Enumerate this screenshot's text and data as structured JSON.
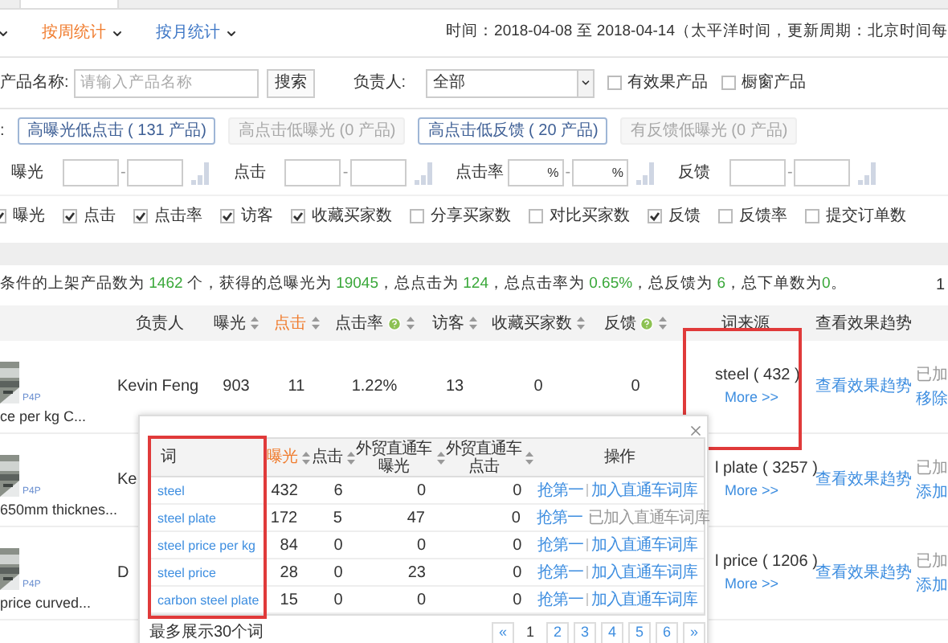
{
  "tabs": [
    {
      "label": "按周统计",
      "selected": true
    },
    {
      "label": "按月统计",
      "selected": false
    }
  ],
  "time_range": "时间：2018-04-08 至 2018-04-14（太平洋时间，更新周期：北京时间每",
  "filters": {
    "product_label": "产品名称:",
    "product_placeholder": "请输入产品名称",
    "search_button": "搜索",
    "owner_label": "负责人:",
    "owner_value": "全部",
    "checkboxes": [
      {
        "label": "有效果产品",
        "checked": false
      },
      {
        "label": "橱窗产品",
        "checked": false
      }
    ]
  },
  "quick_label": ":",
  "quick_filters": [
    {
      "label": "高曝光低点击 ( 131 产品)",
      "disabled": false
    },
    {
      "label": "高点击低曝光 (0 产品)",
      "disabled": true
    },
    {
      "label": "高点击低反馈 ( 20 产品)",
      "disabled": false
    },
    {
      "label": "有反馈低曝光 (0 产品)",
      "disabled": true
    }
  ],
  "ranges": [
    {
      "label": "曝光",
      "separator": "-"
    },
    {
      "label": "点击",
      "separator": "-"
    },
    {
      "label": "点击率",
      "separator": "-",
      "unit": "%"
    },
    {
      "label": "反馈",
      "separator": "-"
    }
  ],
  "columns_toggle": [
    {
      "label": "曝光",
      "checked": true
    },
    {
      "label": "点击",
      "checked": true
    },
    {
      "label": "点击率",
      "checked": true
    },
    {
      "label": "访客",
      "checked": true
    },
    {
      "label": "收藏买家数",
      "checked": true
    },
    {
      "label": "分享买家数",
      "checked": false
    },
    {
      "label": "对比买家数",
      "checked": false
    },
    {
      "label": "反馈",
      "checked": true
    },
    {
      "label": "反馈率",
      "checked": false
    },
    {
      "label": "提交订单数",
      "checked": false
    }
  ],
  "summary": [
    {
      "text": "条件的上架产品数为 ",
      "highlight": false
    },
    {
      "text": "1462",
      "highlight": true
    },
    {
      "text": " 个，获得的总曝光为 ",
      "highlight": false
    },
    {
      "text": "19045",
      "highlight": true
    },
    {
      "text": "，总点击为 ",
      "highlight": false
    },
    {
      "text": "124",
      "highlight": true
    },
    {
      "text": "，总点击率为 ",
      "highlight": false
    },
    {
      "text": "0.65%",
      "highlight": true
    },
    {
      "text": "，总反馈为 ",
      "highlight": false
    },
    {
      "text": "6",
      "highlight": true
    },
    {
      "text": "，总下单数为",
      "highlight": false
    },
    {
      "text": "0",
      "highlight": true
    },
    {
      "text": "。",
      "highlight": false
    }
  ],
  "summary_edge": "1",
  "table": {
    "columns": [
      {
        "label": "负责人",
        "sortable": false,
        "help": false,
        "active": false
      },
      {
        "label": "曝光",
        "sortable": true,
        "help": false,
        "active": false
      },
      {
        "label": "点击",
        "sortable": true,
        "help": false,
        "active": true
      },
      {
        "label": "点击率",
        "sortable": true,
        "help": true,
        "active": false
      },
      {
        "label": "访客",
        "sortable": true,
        "help": false,
        "active": false
      },
      {
        "label": "收藏买家数",
        "sortable": true,
        "help": false,
        "active": false
      },
      {
        "label": "反馈",
        "sortable": true,
        "help": true,
        "active": false
      },
      {
        "label": "词来源",
        "sortable": false,
        "help": false,
        "active": false
      },
      {
        "label": "查看效果趋势",
        "sortable": false,
        "help": false,
        "active": false
      }
    ],
    "rows": [
      {
        "badge": "P4P",
        "product": "ce per kg C...",
        "owner": "Kevin Feng",
        "values": [
          "903",
          "11",
          "1.22%",
          "13",
          "0",
          "0"
        ],
        "source": "steel ( 432 )",
        "more": "More >>",
        "trend": "查看效果趋势",
        "status": "已加",
        "action": "移除"
      },
      {
        "badge": "P4P",
        "product": "650mm thicknes...",
        "owner": "Ke",
        "values": [],
        "source": "l plate ( 3257 )",
        "more": "More >>",
        "trend": "查看效果趋势",
        "status": "已加",
        "action": "添加"
      },
      {
        "badge": "P4P",
        "product": "price curved...",
        "owner": "D",
        "values": [],
        "source": "l price ( 1206 )",
        "more": "More >>",
        "trend": "查看效果趋势",
        "status": "已加",
        "action": "添加"
      }
    ]
  },
  "popup": {
    "columns": [
      {
        "label": "词",
        "sortable": false,
        "active": false
      },
      {
        "label": "曝光",
        "sortable": true,
        "active": true
      },
      {
        "label": "点击",
        "sortable": true,
        "active": false
      },
      {
        "label": "外贸直通车曝光",
        "sortable": true,
        "active": false
      },
      {
        "label": "外贸直通车点击",
        "sortable": true,
        "active": false
      },
      {
        "label": "操作",
        "sortable": false,
        "active": false
      }
    ],
    "rows": [
      {
        "word": "steel",
        "exposure": "432",
        "clicks": "6",
        "p4p_exposure": "0",
        "p4p_clicks": "0",
        "grab": "抢第一",
        "action": "加入直通车词库",
        "added": false
      },
      {
        "word": "steel plate",
        "exposure": "172",
        "clicks": "5",
        "p4p_exposure": "47",
        "p4p_clicks": "0",
        "grab": "抢第一",
        "action": "已加入直通车词库",
        "added": true
      },
      {
        "word": "steel price per kg",
        "exposure": "84",
        "clicks": "0",
        "p4p_exposure": "0",
        "p4p_clicks": "0",
        "grab": "抢第一",
        "action": "加入直通车词库",
        "added": false
      },
      {
        "word": "steel price",
        "exposure": "28",
        "clicks": "0",
        "p4p_exposure": "23",
        "p4p_clicks": "0",
        "grab": "抢第一",
        "action": "加入直通车词库",
        "added": false
      },
      {
        "word": "carbon steel plate",
        "exposure": "15",
        "clicks": "0",
        "p4p_exposure": "0",
        "p4p_clicks": "0",
        "grab": "抢第一",
        "action": "加入直通车词库",
        "added": false
      }
    ],
    "note": "最多展示30个词",
    "pages": [
      {
        "label": "«",
        "selected": false
      },
      {
        "label": "1",
        "selected": true
      },
      {
        "label": "2",
        "selected": false
      },
      {
        "label": "3",
        "selected": false
      },
      {
        "label": "4",
        "selected": false
      },
      {
        "label": "5",
        "selected": false
      },
      {
        "label": "6",
        "selected": false
      },
      {
        "label": "»",
        "selected": false
      }
    ]
  }
}
